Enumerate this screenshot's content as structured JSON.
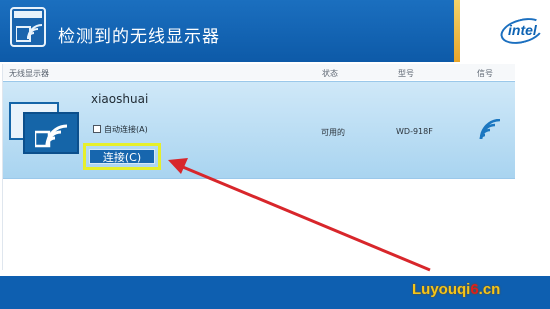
{
  "header": {
    "title": "检测到的无线显示器",
    "logo_tag": "WiDi",
    "brand": "intel"
  },
  "columns": {
    "display": "无线显示器",
    "status": "状态",
    "model": "型号",
    "signal": "信号"
  },
  "device": {
    "name": "xiaoshuai",
    "auto_connect_label": "自动连接(A)",
    "auto_connect_checked": false,
    "connect_label": "连接(C)",
    "status": "可用的",
    "model": "WD-918F",
    "signal_icon": "wifi-signal-icon"
  },
  "watermark": {
    "prefix": "Luyouqi",
    "six": "6",
    "suffix": ".cn"
  },
  "colors": {
    "header_blue": "#1b6fbf",
    "row_blue": "#a9d4f0",
    "highlight_yellow": "#e6ef2a",
    "arrow_red": "#d8262b"
  }
}
